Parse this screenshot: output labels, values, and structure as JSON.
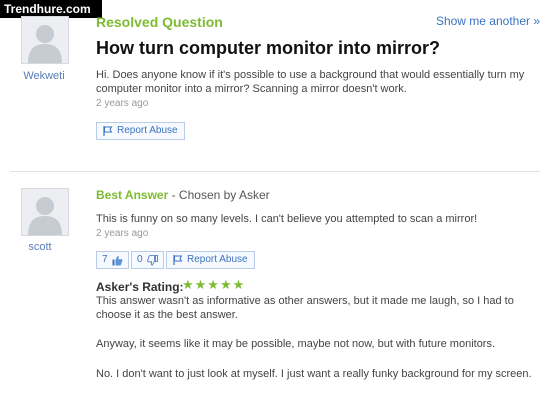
{
  "watermark": "Trendhure.com",
  "question": {
    "section_label": "Resolved Question",
    "show_another": "Show me another »",
    "asker": "Wekweti",
    "title": "How turn computer monitor into mirror?",
    "body": "Hi. Does anyone know if it's possible to use a background that would essentially turn my computer monitor into a mirror? Scanning a mirror doesn't work.",
    "time": "2 years ago",
    "report_label": "Report Abuse"
  },
  "answer": {
    "section_label": "Best Answer",
    "chosen_by": "- Chosen by Asker",
    "answerer": "scott",
    "body": "This is funny on so many levels. I can't believe you attempted to scan a mirror!",
    "time": "2 years ago",
    "thumbs_up_count": "7",
    "thumbs_down_count": "0",
    "report_label": "Report Abuse",
    "rating_label": "Asker's Rating:",
    "rating_stars": "★★★★★",
    "rating_value": 5,
    "comment_1": "This answer wasn't as informative as other answers, but it made me laugh, so I had to choose it as the best answer.",
    "comment_2": "Anyway, it seems like it may be possible, maybe not now, but with future monitors.",
    "comment_3": "No. I don't want to just look at myself. I just want a really funky background for my screen."
  },
  "icons": {
    "flag": "flag-icon",
    "thumbs_up": "thumbs-up-icon",
    "thumbs_down": "thumbs-down-icon",
    "avatar": "default-avatar-icon"
  },
  "colors": {
    "green": "#7dbb33",
    "link": "#3b73c2"
  }
}
